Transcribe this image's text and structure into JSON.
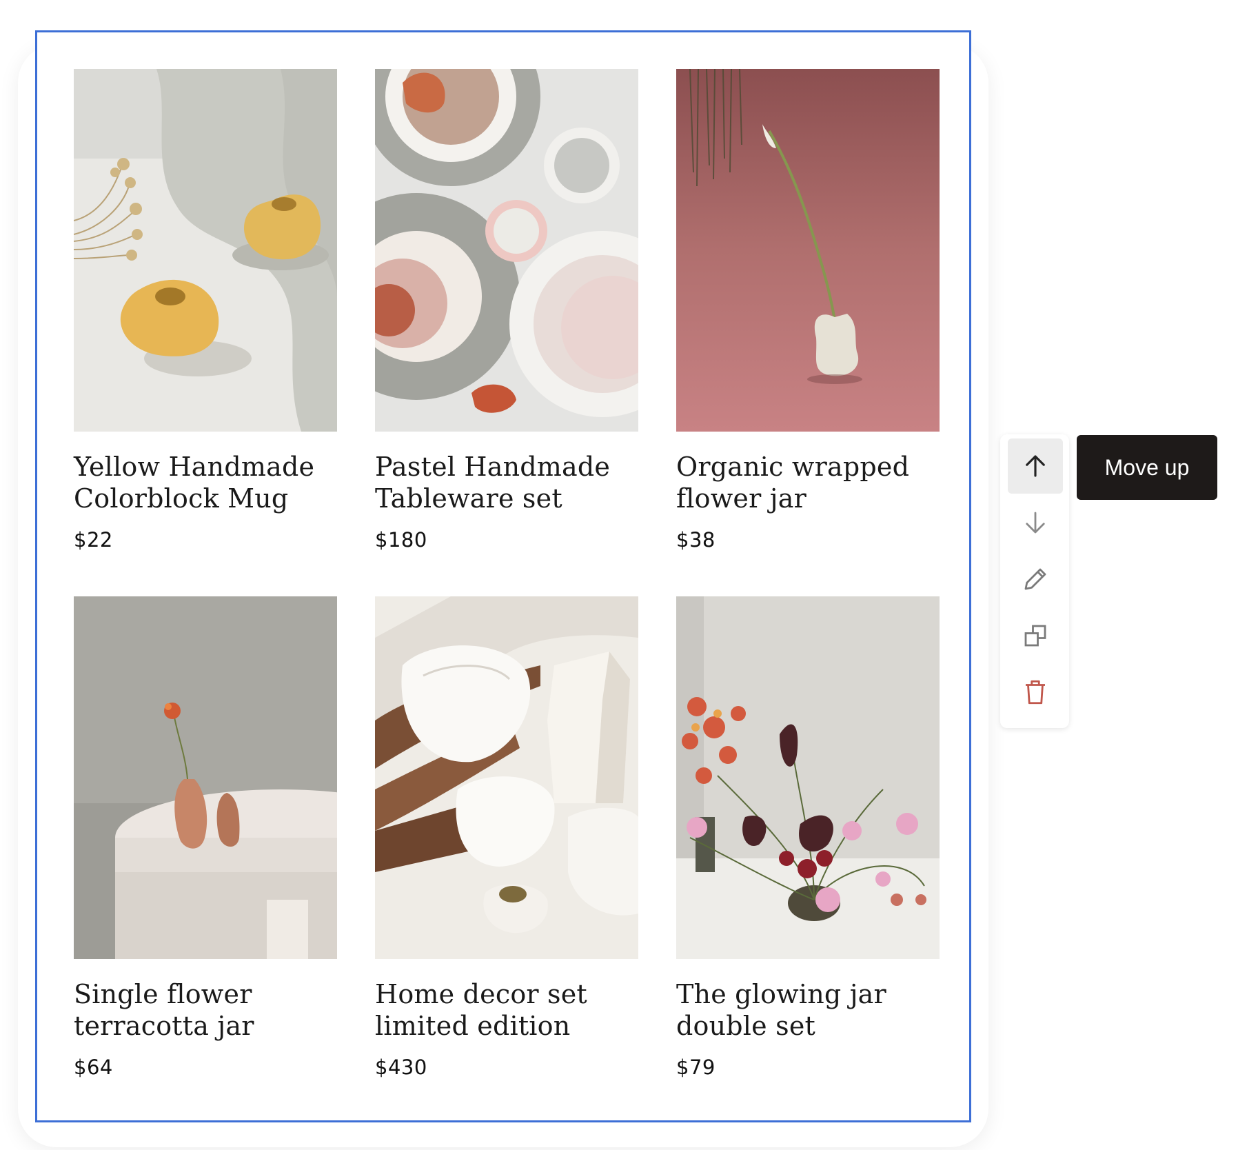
{
  "products": [
    {
      "title_line1": "Yellow Handmade",
      "title_line2": "Colorblock Mug",
      "price": "$22"
    },
    {
      "title_line1": "Pastel Handmade",
      "title_line2": "Tableware set",
      "price": "$180"
    },
    {
      "title_line1": "Organic wrapped",
      "title_line2": "flower jar",
      "price": "$38"
    },
    {
      "title_line1": "Single flower",
      "title_line2": "terracotta jar",
      "price": "$64"
    },
    {
      "title_line1": "Home decor set",
      "title_line2": "limited edition",
      "price": "$430"
    },
    {
      "title_line1": "The glowing jar",
      "title_line2": "double set",
      "price": "$79"
    }
  ],
  "toolbar": {
    "items": [
      "arrow-up-icon",
      "arrow-down-icon",
      "pencil-icon",
      "duplicate-icon",
      "trash-icon"
    ],
    "delete_color": "#c0564b"
  },
  "tooltip": {
    "label": "Move up"
  },
  "colors": {
    "selection_border": "#3d6fd6",
    "tooltip_bg": "#1e1a19"
  }
}
